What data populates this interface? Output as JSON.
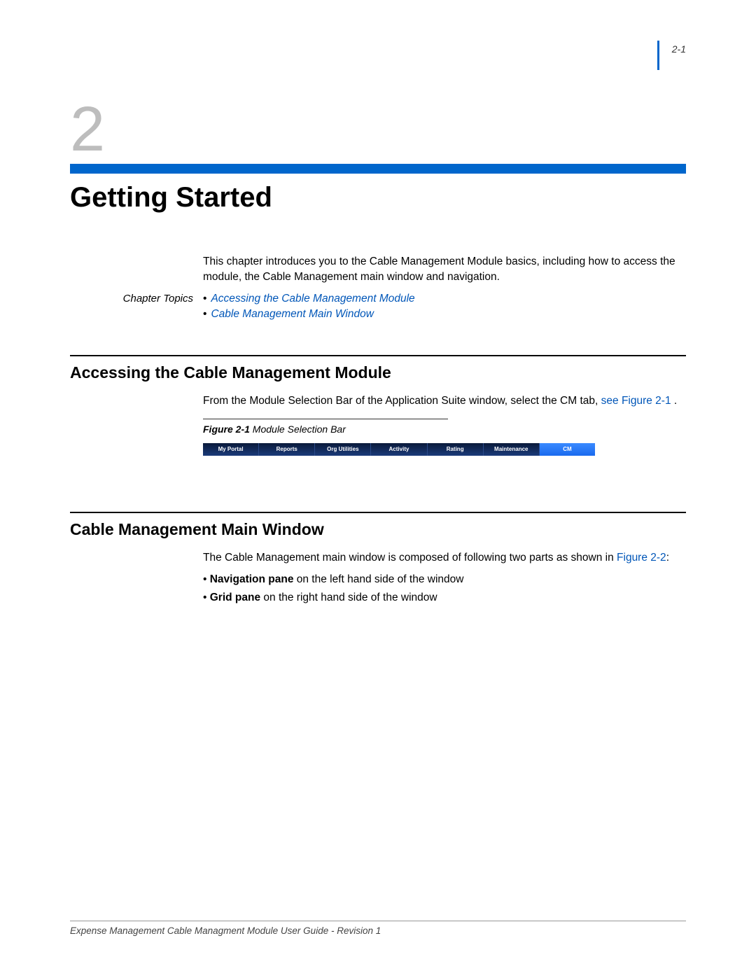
{
  "page_number": "2-1",
  "chapter_number": "2",
  "chapter_title": "Getting Started",
  "intro_paragraph": "This chapter introduces you to the Cable Management Module basics, including how to access the module, the Cable Management main window and navigation.",
  "topics_label": "Chapter Topics",
  "topics": [
    "Accessing the Cable Management Module",
    "Cable Management Main Window"
  ],
  "section1": {
    "heading": "Accessing the Cable Management Module",
    "body_pre": "From the Module Selection Bar of the Application Suite window, select the CM tab, ",
    "body_link": "see Figure 2-1",
    "body_post": " .",
    "fig_label": "Figure 2-1",
    "fig_title": "  Module Selection Bar"
  },
  "module_tabs": [
    {
      "label": "My Portal",
      "active": false
    },
    {
      "label": "Reports",
      "active": false
    },
    {
      "label": "Org Utilities",
      "active": false
    },
    {
      "label": "Activity",
      "active": false
    },
    {
      "label": "Rating",
      "active": false
    },
    {
      "label": "Maintenance",
      "active": false
    },
    {
      "label": "CM",
      "active": true
    }
  ],
  "section2": {
    "heading": "Cable Management Main Window",
    "body_pre": "The Cable Management main window is composed of following two parts as shown in ",
    "body_link": "Figure 2-2",
    "body_post": ":",
    "bullets": [
      {
        "bold": "Navigation pane",
        "rest": " on the left hand side of the window"
      },
      {
        "bold": "Grid pane",
        "rest": " on the right hand side of the window"
      }
    ]
  },
  "footer": "Expense Management Cable Managment Module User Guide - Revision 1"
}
